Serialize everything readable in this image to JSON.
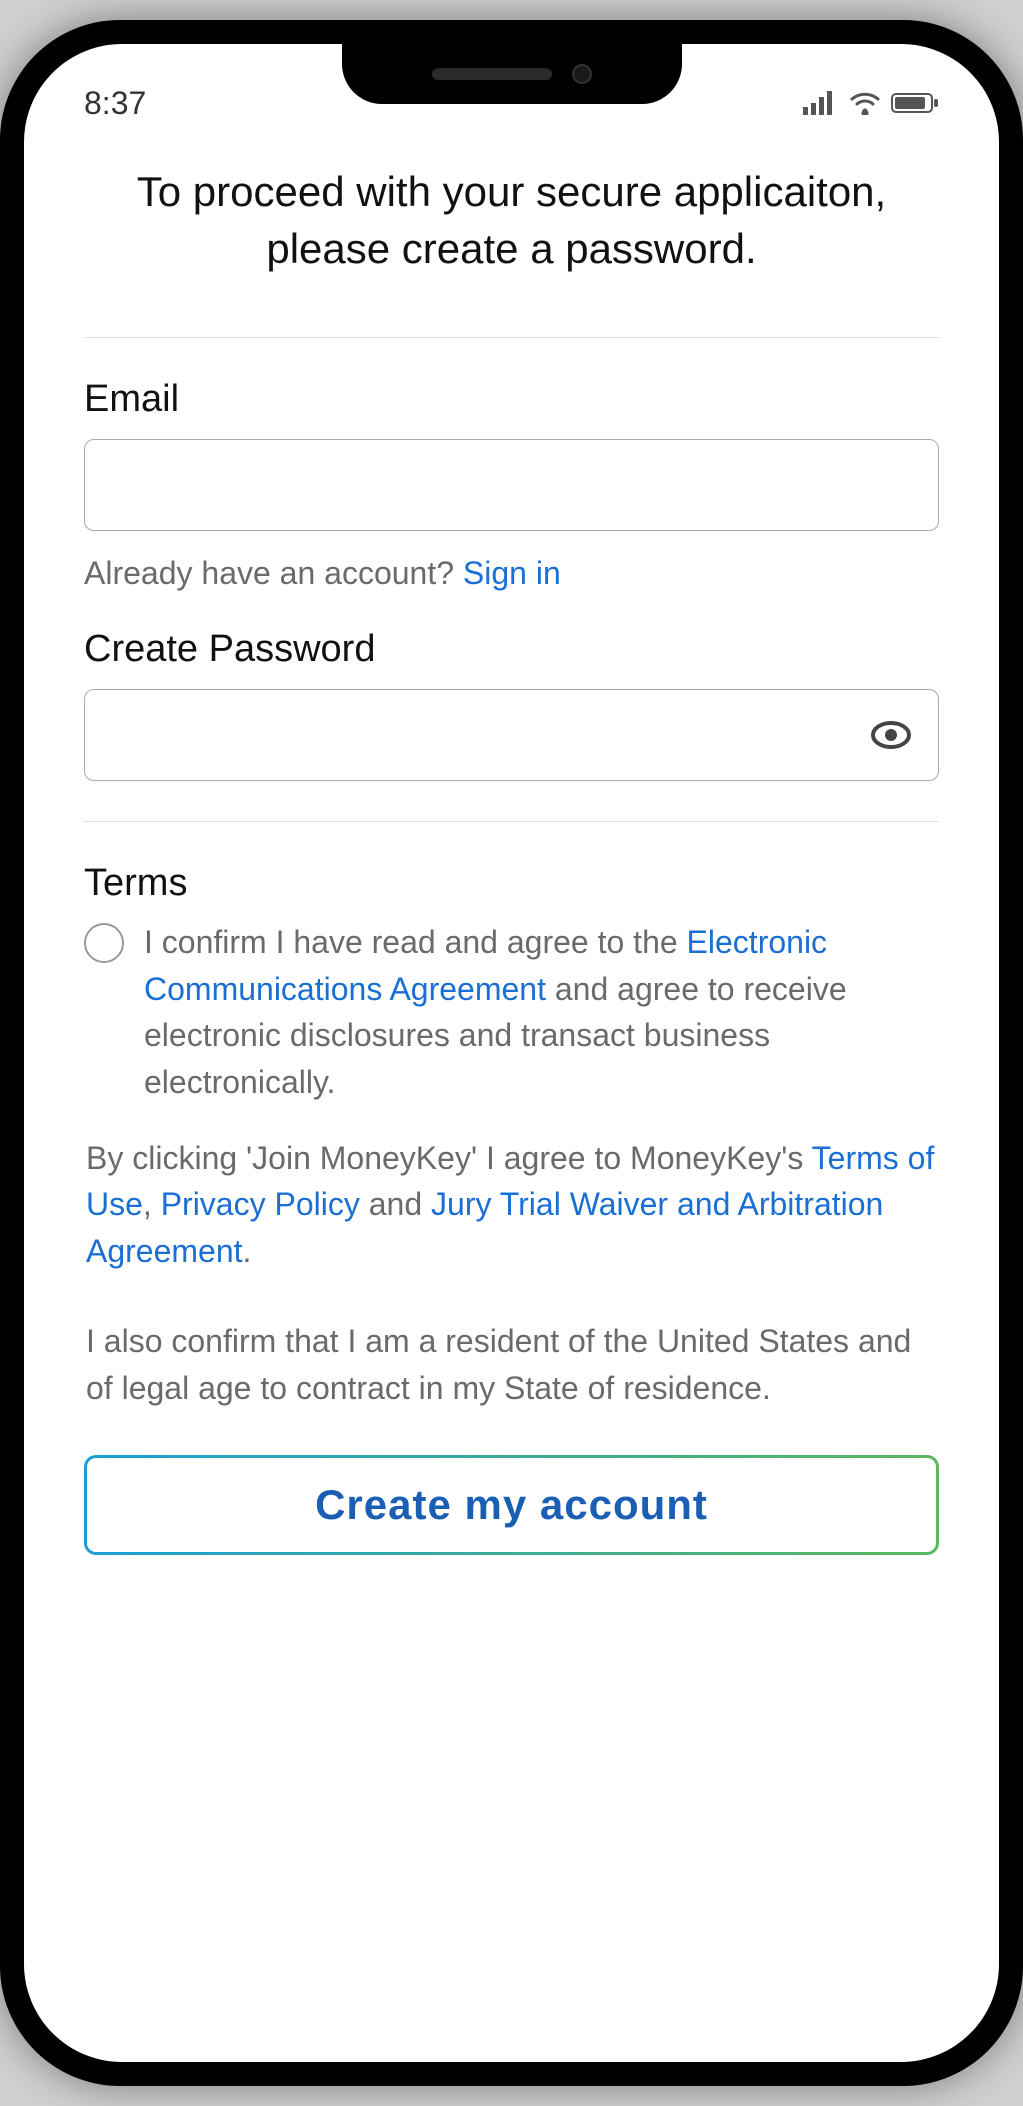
{
  "status_bar": {
    "time": "8:37"
  },
  "heading": "To proceed with your secure applicaiton, please create a password.",
  "form": {
    "email_label": "Email",
    "already_have_text": "Already have an account? ",
    "sign_in_link": "Sign in",
    "password_label": "Create Password"
  },
  "terms": {
    "heading": "Terms",
    "confirm_prefix": "I confirm I have read and agree to the ",
    "eca_link": "Electronic Communications Agreement",
    "confirm_suffix": " and agree to receive electronic disclosures and transact business electronically.",
    "by_clicking_prefix": "By clicking 'Join MoneyKey' I agree to MoneyKey's ",
    "tou_link": "Terms of Use",
    "comma1": ", ",
    "privacy_link": "Privacy Policy",
    "and_text": " and ",
    "jury_link": "Jury Trial Waiver and Arbitration Agreement",
    "period": ".",
    "resident_text": "I also confirm that I am a resident of the United States and of legal age to contract in my State of residence."
  },
  "cta": {
    "label": "Create my account"
  }
}
